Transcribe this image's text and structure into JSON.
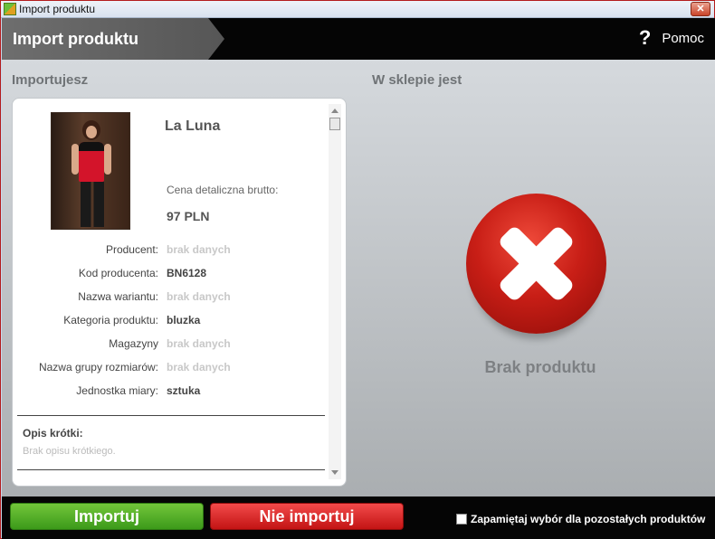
{
  "window": {
    "title": "Import produktu",
    "close_glyph": "✕"
  },
  "header": {
    "title": "Import produktu",
    "help_glyph": "?",
    "help_label": "Pomoc"
  },
  "left": {
    "heading": "Importujesz",
    "product": {
      "name": "La Luna",
      "price_label": "Cena detaliczna brutto:",
      "price_value": "97 PLN",
      "image_icon": "product-photo"
    },
    "attributes": [
      {
        "label": "Producent:",
        "value": "brak danych",
        "empty": true
      },
      {
        "label": "Kod producenta:",
        "value": "BN6128",
        "empty": false
      },
      {
        "label": "Nazwa wariantu:",
        "value": "brak danych",
        "empty": true
      },
      {
        "label": "Kategoria produktu:",
        "value": "bluzka",
        "empty": false
      },
      {
        "label": "Magazyny",
        "value": "brak danych",
        "empty": true
      },
      {
        "label": "Nazwa grupy rozmiarów:",
        "value": "brak danych",
        "empty": true
      },
      {
        "label": "Jednostka miary:",
        "value": "sztuka",
        "empty": false
      }
    ],
    "short_description": {
      "label": "Opis krótki:",
      "text": "Brak opisu krótkiego."
    }
  },
  "right": {
    "heading": "W sklepie jest",
    "status_icon": "x-circle-icon",
    "status_text": "Brak produktu"
  },
  "footer": {
    "import_label": "Importuj",
    "no_import_label": "Nie importuj",
    "remember_label": "Zapamiętaj wybór dla pozostałych produktów",
    "remember_checked": false
  },
  "colors": {
    "import": "#3c9a1a",
    "no_import": "#c31414",
    "missing": "#c81e16",
    "header_bg": "#050505"
  }
}
